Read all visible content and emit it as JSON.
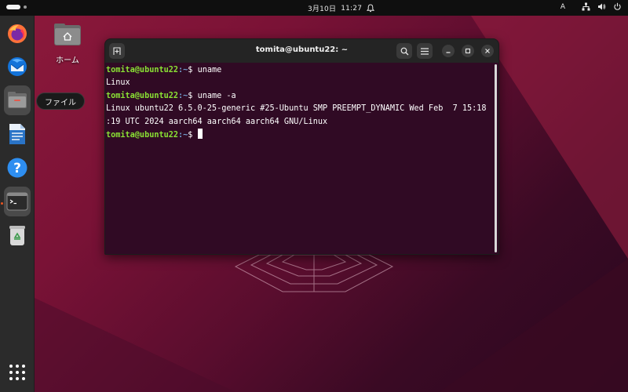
{
  "topbar": {
    "date": "3月10日",
    "time": "11:27",
    "input_method": "A",
    "icons": [
      "network-icon",
      "volume-icon",
      "power-icon"
    ]
  },
  "dock": {
    "items": [
      {
        "name": "firefox",
        "icon": "firefox-icon"
      },
      {
        "name": "thunderbird",
        "icon": "thunderbird-icon"
      },
      {
        "name": "files",
        "icon": "files-icon"
      },
      {
        "name": "libreoffice-writer",
        "icon": "writer-icon"
      },
      {
        "name": "help",
        "icon": "help-icon"
      },
      {
        "name": "terminal",
        "icon": "terminal-icon"
      },
      {
        "name": "trash",
        "icon": "trash-icon"
      }
    ],
    "tooltip": "ファイル",
    "show_apps_icon": "grid-icon"
  },
  "desktop": {
    "home_label": "ホーム"
  },
  "terminal": {
    "title": "tomita@ubuntu22: ~",
    "prompt_user": "tomita@ubuntu22",
    "prompt_path": ":~",
    "prompt_sign": "$ ",
    "lines": [
      {
        "type": "cmd",
        "text": "uname"
      },
      {
        "type": "out",
        "text": "Linux"
      },
      {
        "type": "cmd",
        "text": "uname -a"
      },
      {
        "type": "out",
        "text": "Linux ubuntu22 6.5.0-25-generic #25-Ubuntu SMP PREEMPT_DYNAMIC Wed Feb  7 15:18"
      },
      {
        "type": "out",
        "text": ":19 UTC 2024 aarch64 aarch64 aarch64 GNU/Linux"
      },
      {
        "type": "cmd",
        "text": ""
      }
    ]
  },
  "colors": {
    "terminal_bg": "#300a24",
    "prompt_user": "#8ae234",
    "prompt_path": "#729fcf",
    "accent": "#e95420"
  }
}
